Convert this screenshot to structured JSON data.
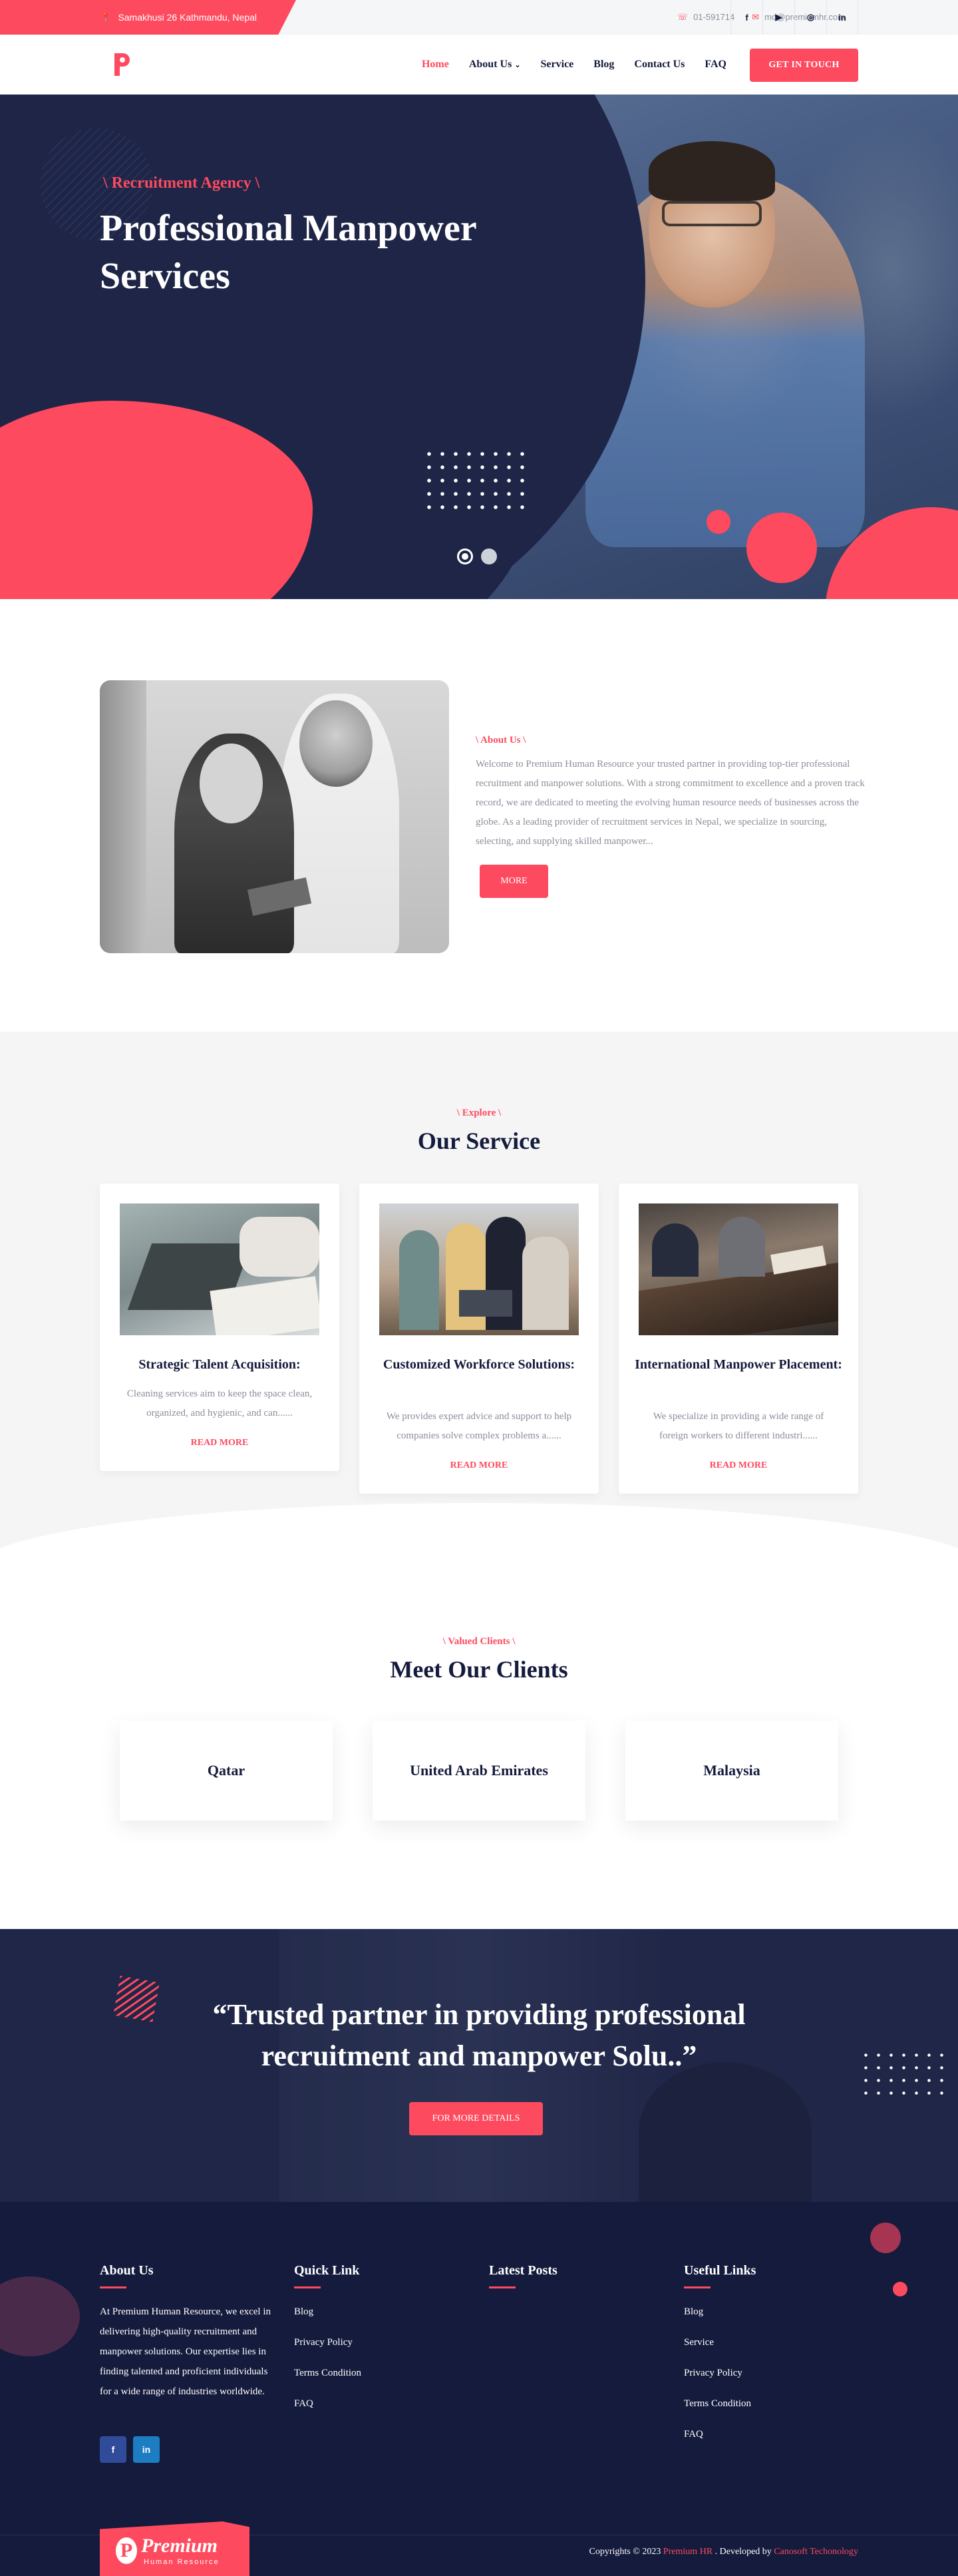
{
  "topbar": {
    "address": "Samakhusi 26 Kathmandu, Nepal",
    "phone": "01-591714",
    "email": "md@premiumhr.com",
    "social": [
      "f",
      "▶",
      "◎",
      "in"
    ]
  },
  "nav": {
    "logo_letter": "P",
    "items": [
      "Home",
      "About Us",
      "Service",
      "Blog",
      "Contact Us",
      "FAQ"
    ],
    "cta": "GET IN TOUCH"
  },
  "hero": {
    "tag": "\\ Recruitment Agency \\",
    "title": "Professional Manpower Services"
  },
  "about": {
    "tag": "\\ About Us \\",
    "text": "Welcome to Premium Human Resource your trusted partner in providing top-tier professional recruitment and manpower solutions. With a strong commitment to excellence and a proven track record, we are dedicated to meeting the evolving human resource needs of businesses across the globe. As a leading provider of recruitment services in Nepal, we specialize in sourcing, selecting, and supplying skilled manpower...",
    "button": "MORE"
  },
  "services": {
    "tag": "\\ Explore \\",
    "title": "Our Service",
    "cards": [
      {
        "title": "Strategic Talent Acquisition:",
        "text": "Cleaning services aim to keep the space clean, organized, and hygienic, and can......",
        "link": "READ MORE"
      },
      {
        "title": "Customized Workforce Solutions:",
        "text": "We provides expert advice and support to help companies solve complex problems a......",
        "link": "READ MORE"
      },
      {
        "title": "International Manpower Placement:",
        "text": "We specialize in providing a wide range of foreign workers to different industri......",
        "link": "READ MORE"
      }
    ]
  },
  "clients": {
    "tag": "\\ Valued Clients \\",
    "title": "Meet Our Clients",
    "items": [
      "Qatar",
      "United Arab Emirates",
      "Malaysia"
    ]
  },
  "quote": {
    "text": "“Trusted partner in providing professional recruitment and manpower Solu..”",
    "button": "FOR MORE DETAILS"
  },
  "footer": {
    "about_title": "About Us",
    "about_text": "At Premium Human Resource, we excel in delivering high-quality recruitment and manpower solutions. Our expertise lies in finding talented and proficient individuals for a wide range of industries worldwide.",
    "social": [
      "f",
      "in"
    ],
    "quick_title": "Quick Link",
    "quick_links": [
      "Blog",
      "Privacy Policy",
      "Terms Condition",
      "FAQ"
    ],
    "posts_title": "Latest Posts",
    "useful_title": "Useful Links",
    "useful_links": [
      "Blog",
      "Service",
      "Privacy Policy",
      "Terms Condition",
      "FAQ"
    ],
    "logo_name": "Premium",
    "logo_sub": "Human Resource",
    "copyright_prefix": "Copyrights © 2023",
    "copyright_brand": "Premium HR",
    "copyright_mid": ". Developed by",
    "copyright_dev": "Canosoft Techonology"
  },
  "colors": {
    "accent": "#fe4a5e",
    "navy": "#141b3c"
  }
}
